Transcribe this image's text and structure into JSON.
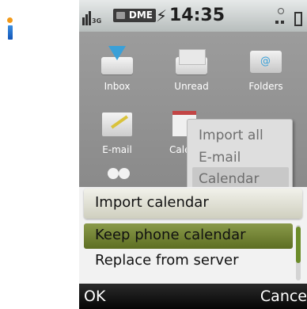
{
  "status_bar": {
    "network": "3G",
    "carrier": "DME",
    "time": "14:35"
  },
  "menu_grid": {
    "items": [
      {
        "label": "Inbox",
        "icon": "inbox-icon"
      },
      {
        "label": "Unread",
        "icon": "unread-icon"
      },
      {
        "label": "Folders",
        "icon": "folders-icon"
      },
      {
        "label": "E-mail",
        "icon": "email-compose-icon"
      },
      {
        "label": "Cale",
        "icon": "calendar-icon"
      },
      {
        "label": "",
        "icon": "contacts-icon"
      }
    ]
  },
  "context_menu": {
    "items": [
      "Import all",
      "E-mail",
      "Calendar"
    ]
  },
  "dialog": {
    "title": "Import calendar",
    "options": [
      "Keep phone calendar",
      "Replace from server"
    ],
    "selected_index": 0
  },
  "softkeys": {
    "left": "OK",
    "right": "Cance"
  },
  "colors": {
    "accent_green": "#6c8c2a",
    "info_orange": "#f29a1a",
    "info_blue": "#1f6fce"
  }
}
